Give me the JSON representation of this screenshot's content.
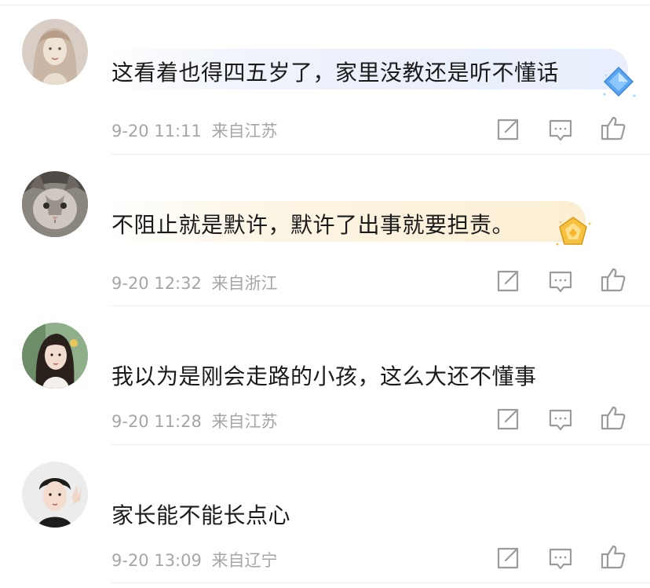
{
  "comments": [
    {
      "avatar": "avatar-girl-sketch",
      "text": "这看着也得四五岁了，家里没教还是听不懂话",
      "date": "9-20 11:11",
      "location": "来自江苏",
      "badge": "diamond-badge-icon"
    },
    {
      "avatar": "avatar-cat",
      "text": "不阻止就是默许，默许了出事就要担责。",
      "date": "9-20 12:32",
      "location": "来自浙江",
      "badge": "gold-crown-badge-icon"
    },
    {
      "avatar": "avatar-girl-photo",
      "text": "我以为是刚会走路的小孩，这么大还不懂事",
      "date": "9-20 11:28",
      "location": "来自江苏",
      "badge": ""
    },
    {
      "avatar": "avatar-man-photo",
      "text": "家长能不能长点心",
      "date": "9-20 13:09",
      "location": "来自辽宁",
      "badge": ""
    }
  ],
  "actions": [
    "share-icon",
    "reply-icon",
    "like-icon"
  ],
  "colors": {
    "text": "#1a1a1a",
    "meta": "#a6a6a6",
    "icon": "#9b9b9b",
    "bubble_blue": "#eef2fb",
    "bubble_gold": "#fdf5e4"
  }
}
